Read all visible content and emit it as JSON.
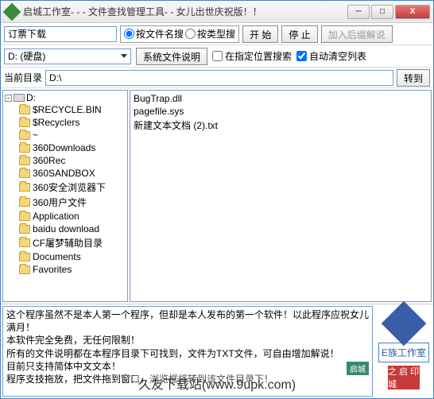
{
  "title": "启城工作室- - - 文件查找管理工具- - 女儿出世庆祝版！！",
  "toolbar1": {
    "search_input": "订票下载",
    "radio_name": "按文件名搜",
    "radio_type": "按类型搜",
    "btn_start": "开 始",
    "btn_stop": "停 止",
    "btn_append": "加入后缀解说"
  },
  "toolbar2": {
    "drive": "D: (硬盘)",
    "btn_sysfile": "系统文件说明",
    "chk_location": "在指定位置搜索",
    "chk_autoclear": "自动清空列表",
    "autoclear_checked": true
  },
  "toolbar3": {
    "label": "当前目录",
    "path": "D:\\",
    "btn_go": "转到"
  },
  "tree": {
    "root": "D:",
    "items": [
      "$RECYCLE.BIN",
      "$Recyclers",
      "~",
      "360Downloads",
      "360Rec",
      "360SANDBOX",
      "360安全浏览器下",
      "360用户文件",
      "Application",
      "baidu download",
      "CF屠梦辅助目录",
      "Documents",
      "Favorites"
    ]
  },
  "files": [
    "BugTrap.dll",
    "pagefile.sys",
    "新建文本文档 (2).txt"
  ],
  "description": "这个程序虽然不是本人第一个程序，但却是本人发布的第一个软件！以此程序应祝女儿满月！\n本软件完全免费，无任何限制！\n所有的文件说明都在本程序目录下可找到，文件为TXT文件，可自由增加解说！\n目前只支持简体中文文本！\n程序支技拖放，把文件拖到窗口，浏览框将转到该文件目录下！",
  "side": {
    "btn_studio": "E族工作室",
    "logo_red": "之 启\n印城"
  },
  "watermark": "久友下载站(www.9upk.com)",
  "badge": "启城"
}
